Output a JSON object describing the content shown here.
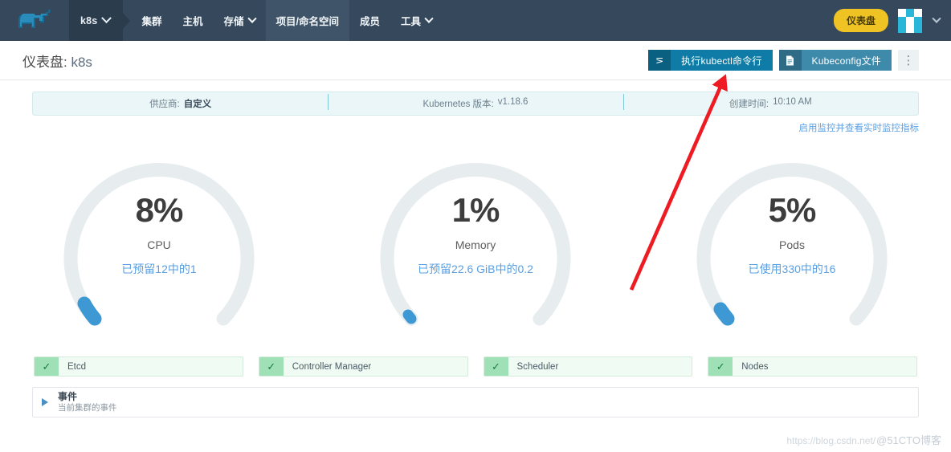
{
  "header": {
    "logo_name": "rancher-cow-logo",
    "cluster": {
      "label": "k8s",
      "caret": "chevron-down-icon"
    },
    "nav": [
      {
        "label": "集群",
        "has_caret": false,
        "active": false
      },
      {
        "label": "主机",
        "has_caret": false,
        "active": false
      },
      {
        "label": "存储",
        "has_caret": true,
        "active": false
      },
      {
        "label": "项目/命名空间",
        "has_caret": false,
        "active": true
      },
      {
        "label": "成员",
        "has_caret": false,
        "active": false
      },
      {
        "label": "工具",
        "has_caret": true,
        "active": false
      }
    ],
    "dashboard_pill": "仪表盘",
    "avatar_caret": "chevron-down-icon"
  },
  "title_row": {
    "title_prefix": "仪表盘:",
    "title_value": "k8s",
    "buttons": {
      "kubectl": {
        "label": "执行kubectl命令行",
        "icon": "terminal-prompt-icon"
      },
      "kubeconfig": {
        "label": "Kubeconfig文件",
        "icon": "document-icon"
      },
      "kebab": "⋮"
    }
  },
  "info_bar": [
    {
      "label": "供应商:",
      "value": "自定义",
      "bold": true
    },
    {
      "label": "Kubernetes 版本:",
      "value": "v1.18.6",
      "bold": false
    },
    {
      "label": "创建时间:",
      "value": "10:10 AM",
      "bold": false
    }
  ],
  "monitor_link": "启用监控并查看实时监控指标",
  "gauges": [
    {
      "percent": "8%",
      "name": "CPU",
      "detail": "已预留12中的1",
      "value": 8
    },
    {
      "percent": "1%",
      "name": "Memory",
      "detail": "已预留22.6 GiB中的0.2",
      "value": 1
    },
    {
      "percent": "5%",
      "name": "Pods",
      "detail": "已使用330中的16",
      "value": 5
    }
  ],
  "components": [
    {
      "label": "Etcd",
      "status": "healthy",
      "icon": "check-icon"
    },
    {
      "label": "Controller Manager",
      "status": "healthy",
      "icon": "check-icon"
    },
    {
      "label": "Scheduler",
      "status": "healthy",
      "icon": "check-icon"
    },
    {
      "label": "Nodes",
      "status": "healthy",
      "icon": "check-icon"
    }
  ],
  "events": {
    "title": "事件",
    "subtitle": "当前集群的事件",
    "expander": "triangle-right-icon"
  },
  "watermark": {
    "url": "https://blog.csdn.net/",
    "brand": "@51CTO博客"
  },
  "colors": {
    "header_bg": "#35485c",
    "accent_blue": "#3d98d3",
    "track_gray": "#e7ecee",
    "pill_yellow": "#f0c325",
    "button_teal": "#0e7ca6",
    "healthy_green": "#9fe0b7",
    "annotation_red": "#ee1c22"
  },
  "chart_data": {
    "type": "gauge",
    "title": "Cluster resource utilization",
    "series": [
      {
        "name": "CPU",
        "value": 8,
        "unit": "%",
        "used": 1,
        "total": 12,
        "detail": "已预留12中的1"
      },
      {
        "name": "Memory",
        "value": 1,
        "unit": "%",
        "used": 0.2,
        "total": 22.6,
        "total_unit": "GiB",
        "detail": "已预留22.6 GiB中的0.2"
      },
      {
        "name": "Pods",
        "value": 5,
        "unit": "%",
        "used": 16,
        "total": 330,
        "detail": "已使用330中的16"
      }
    ],
    "ylim": [
      0,
      100
    ],
    "legend": "none",
    "grid": false
  }
}
